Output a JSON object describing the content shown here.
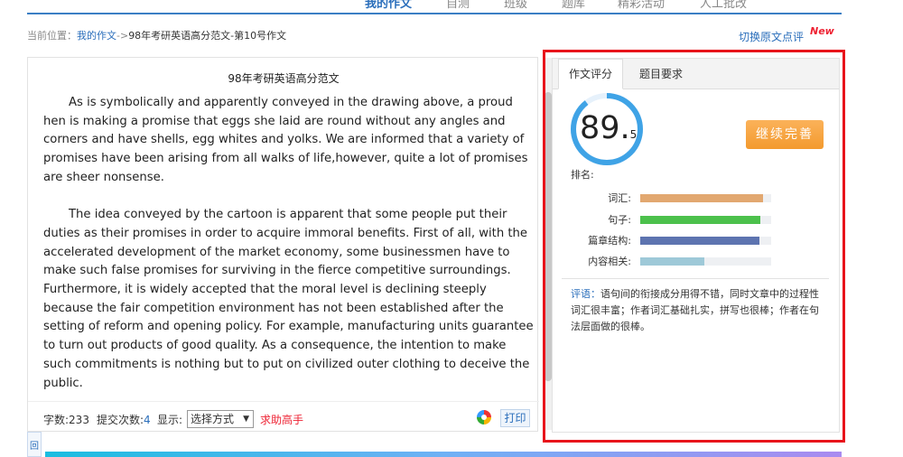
{
  "nav": {
    "items": [
      {
        "label": "我的作文",
        "active": true
      },
      {
        "label": "自测",
        "active": false
      },
      {
        "label": "班级",
        "active": false
      },
      {
        "label": "题库",
        "active": false
      },
      {
        "label": "精彩活动",
        "active": false
      },
      {
        "label": "人工批改",
        "active": false
      }
    ]
  },
  "breadcrumb": {
    "prefix": "当前位置：",
    "link": "我的作文",
    "separator": "->",
    "current": "98年考研英语高分范文-第10号作文"
  },
  "switch_link": "切换原文点评",
  "new_badge": "New",
  "essay": {
    "title": "98年考研英语高分范文",
    "paragraphs": [
      "As is symbolically and apparently conveyed in the drawing above, a proud hen is making a promise that eggs she laid are round without any angles and corners and have shells, egg whites and yolks. We are informed that a variety of promises have been arising from all walks of life,however, quite a lot of promises are sheer nonsense.",
      "The idea conveyed by the cartoon is apparent that some people put their duties as their promises in order to acquire immoral benefits. First of all, with the accelerated development of the market economy, some businessmen have to make such false promises for surviving in the fierce competitive surroundings. Furthermore, it is widely accepted that the moral level is declining steeply because the fair competition environment has not been established after the setting of reform and opening policy. For example, manufacturing units guarantee to turn out products of good quality. As a consequence, the intention to make such commitments is nothing but to put on civilized outer clothing to deceive the public."
    ]
  },
  "footer": {
    "word_count_label": "字数:233",
    "submit_label": "提交次数:",
    "submit_count": "4",
    "display_label": "显示:",
    "select_value": "选择方式",
    "ask_link": "求助高手",
    "print_label": "打印"
  },
  "mini_bar_label": "回",
  "score_panel": {
    "tabs": [
      "作文评分",
      "题目要求"
    ],
    "score_int": "89.",
    "score_dec": "5",
    "score_value": 89.5,
    "continue_label": "继续完善",
    "rank_label": "排名:",
    "metrics": [
      {
        "label": "词汇:",
        "value": 0.94,
        "color": "#e2a870"
      },
      {
        "label": "句子:",
        "value": 0.92,
        "color": "#4cc14c"
      },
      {
        "label": "篇章结构:",
        "value": 0.91,
        "color": "#5d74b0"
      },
      {
        "label": "内容相关:",
        "value": 0.49,
        "color": "#9ec9d8"
      }
    ],
    "comment_label": "评语：",
    "comment_text": "语句间的衔接成分用得不错，同时文章中的过程性词汇很丰富；作者词汇基础扎实，拼写也很棒；作者在句法层面做的很棒。"
  },
  "colors": {
    "accent": "#2a6ebb",
    "ring": "#3fa3e6",
    "highlight_frame": "#e8141b",
    "button": "#f39a2e"
  }
}
